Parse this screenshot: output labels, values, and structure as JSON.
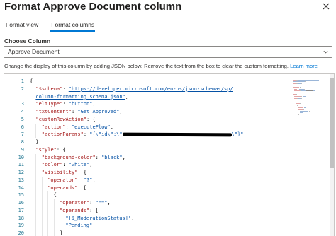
{
  "panel": {
    "title": "Format Approve Document column"
  },
  "tabs": [
    {
      "label": "Format view",
      "active": false
    },
    {
      "label": "Format columns",
      "active": true
    }
  ],
  "choose_column": {
    "label": "Choose Column",
    "selected": "Approve Document"
  },
  "description": {
    "text": "Change the display of this column by adding JSON below. Remove the text from the box to clear the custom formatting.",
    "link": "Learn more"
  },
  "editor": {
    "line_numbers": [
      "1",
      "2",
      "",
      "3",
      "4",
      "5",
      "6",
      "7",
      "8",
      "9",
      "10",
      "11",
      "12",
      "13",
      "14",
      "15",
      "16",
      "17",
      "18",
      "19",
      "20"
    ],
    "lines": [
      {
        "indent": 0,
        "parts": [
          {
            "t": "{",
            "c": "p"
          }
        ]
      },
      {
        "indent": 1,
        "parts": [
          {
            "t": "\"$schema\"",
            "c": "k"
          },
          {
            "t": ": ",
            "c": "p"
          },
          {
            "t": "\"https://developer.microsoft.com/en-us/json-schemas/sp/",
            "c": "s",
            "u": true
          }
        ]
      },
      {
        "indent": 1,
        "parts": [
          {
            "t": "column-formatting.schema.json\"",
            "c": "s",
            "u": true
          },
          {
            "t": ",",
            "c": "p"
          }
        ]
      },
      {
        "indent": 1,
        "parts": [
          {
            "t": "\"elmType\"",
            "c": "k"
          },
          {
            "t": ": ",
            "c": "p"
          },
          {
            "t": "\"button\"",
            "c": "s"
          },
          {
            "t": ",",
            "c": "p"
          }
        ]
      },
      {
        "indent": 1,
        "parts": [
          {
            "t": "\"txtContent\"",
            "c": "k"
          },
          {
            "t": ": ",
            "c": "p"
          },
          {
            "t": "\"Get Approved\"",
            "c": "s"
          },
          {
            "t": ",",
            "c": "p"
          }
        ]
      },
      {
        "indent": 1,
        "parts": [
          {
            "t": "\"customRowAction\"",
            "c": "k"
          },
          {
            "t": ": {",
            "c": "p"
          }
        ]
      },
      {
        "indent": 2,
        "parts": [
          {
            "t": "\"action\"",
            "c": "k"
          },
          {
            "t": ": ",
            "c": "p"
          },
          {
            "t": "\"executeFlow\"",
            "c": "s"
          },
          {
            "t": ",",
            "c": "p"
          }
        ]
      },
      {
        "indent": 2,
        "parts": [
          {
            "t": "\"actionParams\"",
            "c": "k"
          },
          {
            "t": ": ",
            "c": "p"
          },
          {
            "t": "\"{\\\"id\\\":\\\"",
            "c": "s"
          },
          {
            "t": "",
            "c": "redact"
          },
          {
            "t": "\\\"}\"",
            "c": "s"
          }
        ]
      },
      {
        "indent": 1,
        "parts": [
          {
            "t": "},",
            "c": "p"
          }
        ]
      },
      {
        "indent": 1,
        "parts": [
          {
            "t": "\"style\"",
            "c": "k"
          },
          {
            "t": ": {",
            "c": "p"
          }
        ]
      },
      {
        "indent": 2,
        "parts": [
          {
            "t": "\"background-color\"",
            "c": "k"
          },
          {
            "t": ": ",
            "c": "p"
          },
          {
            "t": "\"black\"",
            "c": "s"
          },
          {
            "t": ",",
            "c": "p"
          }
        ]
      },
      {
        "indent": 2,
        "parts": [
          {
            "t": "\"color\"",
            "c": "k"
          },
          {
            "t": ": ",
            "c": "p"
          },
          {
            "t": "\"white\"",
            "c": "s"
          },
          {
            "t": ",",
            "c": "p"
          }
        ]
      },
      {
        "indent": 2,
        "parts": [
          {
            "t": "\"visibility\"",
            "c": "k"
          },
          {
            "t": ": {",
            "c": "p"
          }
        ]
      },
      {
        "indent": 3,
        "parts": [
          {
            "t": "\"operator\"",
            "c": "k"
          },
          {
            "t": ": ",
            "c": "p"
          },
          {
            "t": "\"?\"",
            "c": "s"
          },
          {
            "t": ",",
            "c": "p"
          }
        ]
      },
      {
        "indent": 3,
        "parts": [
          {
            "t": "\"operands\"",
            "c": "k"
          },
          {
            "t": ": [",
            "c": "p"
          }
        ]
      },
      {
        "indent": 4,
        "parts": [
          {
            "t": "{",
            "c": "p"
          }
        ]
      },
      {
        "indent": 5,
        "parts": [
          {
            "t": "\"operator\"",
            "c": "k"
          },
          {
            "t": ": ",
            "c": "p"
          },
          {
            "t": "\"==\"",
            "c": "s"
          },
          {
            "t": ",",
            "c": "p"
          }
        ]
      },
      {
        "indent": 5,
        "parts": [
          {
            "t": "\"operands\"",
            "c": "k"
          },
          {
            "t": ": [",
            "c": "p"
          }
        ]
      },
      {
        "indent": 6,
        "parts": [
          {
            "t": "\"[$_ModerationStatus]\"",
            "c": "s"
          },
          {
            "t": ",",
            "c": "p"
          }
        ]
      },
      {
        "indent": 6,
        "parts": [
          {
            "t": "\"Pending\"",
            "c": "s"
          }
        ]
      },
      {
        "indent": 5,
        "parts": [
          {
            "t": "]",
            "c": "p"
          }
        ]
      }
    ]
  },
  "colors": {
    "accent": "#0078d4",
    "json_key": "#a31515",
    "json_string": "#0451a5",
    "line_number": "#237893"
  }
}
